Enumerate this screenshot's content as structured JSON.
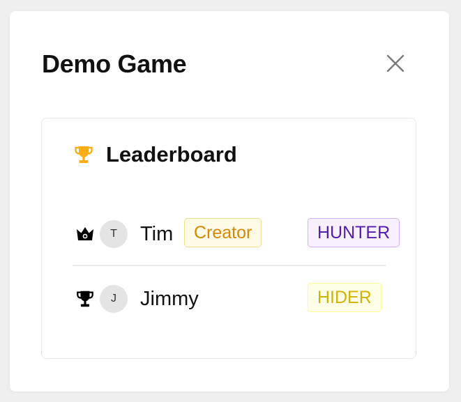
{
  "modal": {
    "title": "Demo Game",
    "close_icon": "close-icon"
  },
  "leaderboard": {
    "title": "Leaderboard",
    "title_icon": "trophy-icon",
    "title_icon_color": "#faad14",
    "players": [
      {
        "rank_icon": "crown-icon",
        "avatar_initial": "T",
        "name": "Tim",
        "creator_badge": "Creator",
        "role": "HUNTER",
        "role_color": "#531dab"
      },
      {
        "rank_icon": "trophy-icon",
        "avatar_initial": "J",
        "name": "Jimmy",
        "role": "HIDER",
        "role_color": "#d4b106"
      }
    ]
  },
  "colors": {
    "creator_badge_text": "#d48806",
    "creator_badge_bg": "#fffbe6",
    "hunter_badge_bg": "#f9f0ff",
    "hider_badge_bg": "#feffe6"
  }
}
